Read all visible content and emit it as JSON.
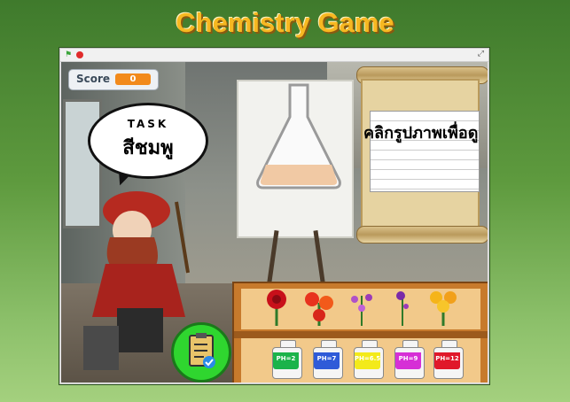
{
  "title": "Chemistry Game",
  "score": {
    "label": "Score",
    "value": "0"
  },
  "task": {
    "label": "TASK",
    "color_text": "สีชมพู"
  },
  "scroll": {
    "prompt": "คลิกรูปภาพเพื่อดู"
  },
  "flowers": [
    "rose-icon",
    "red-flower-icon",
    "purple-flower-icon",
    "small-purple-flower-icon",
    "yellow-flower-icon"
  ],
  "bottles": [
    {
      "label": "PH=2",
      "color": "#1bb34a"
    },
    {
      "label": "PH=7",
      "color": "#2f5bd8"
    },
    {
      "label": "PH=6.5",
      "color": "#f3ea1a"
    },
    {
      "label": "PH=9",
      "color": "#d62fd6"
    },
    {
      "label": "PH=12",
      "color": "#e0182a"
    }
  ],
  "flask_liquid_color": "#f1c9a4",
  "checklist_color": "#2fd62f"
}
